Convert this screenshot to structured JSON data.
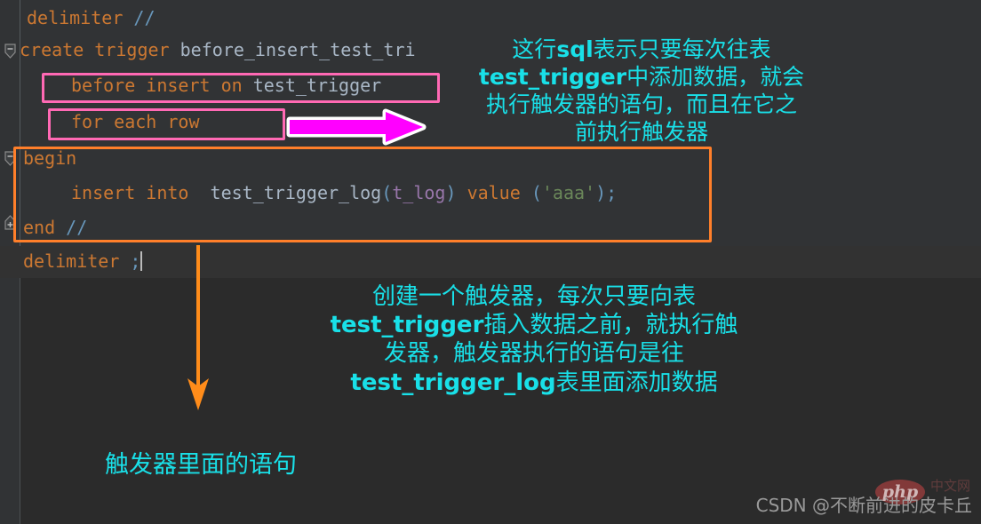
{
  "editor": {
    "background_color": "#2b2b2b",
    "code_background_color": "#313335",
    "lines": [
      {
        "id": "line-delimiter-open",
        "indent": 0,
        "tokens": [
          {
            "text": "delimiter ",
            "cls": "kw"
          },
          {
            "text": "//",
            "cls": "op"
          }
        ],
        "plain": "delimiter //"
      },
      {
        "id": "line-create-trigger",
        "indent": 0,
        "tokens": [
          {
            "text": "create trigger ",
            "cls": "kw"
          },
          {
            "text": "before_insert_test_tri",
            "cls": "id"
          }
        ],
        "plain": "create trigger before_insert_test_tri"
      },
      {
        "id": "line-before-insert-on",
        "indent": 1,
        "tokens": [
          {
            "text": "before insert on ",
            "cls": "kw"
          },
          {
            "text": "test_trigger",
            "cls": "id"
          }
        ],
        "plain": "before insert on test_trigger"
      },
      {
        "id": "line-for-each-row",
        "indent": 1,
        "tokens": [
          {
            "text": "for each row",
            "cls": "kw"
          }
        ],
        "plain": "for each row"
      },
      {
        "id": "line-begin",
        "indent": 0,
        "tokens": [
          {
            "text": "begin",
            "cls": "kw"
          }
        ],
        "plain": "begin"
      },
      {
        "id": "line-insert-into",
        "indent": 1,
        "tokens": [
          {
            "text": "insert into ",
            "cls": "kw"
          },
          {
            "text": " test_trigger_log",
            "cls": "id"
          },
          {
            "text": "(",
            "cls": "op"
          },
          {
            "text": "t_log",
            "cls": "fld"
          },
          {
            "text": ") ",
            "cls": "op"
          },
          {
            "text": "value ",
            "cls": "kw"
          },
          {
            "text": "(",
            "cls": "op"
          },
          {
            "text": "'aaa'",
            "cls": "str"
          },
          {
            "text": ");",
            "cls": "op"
          }
        ],
        "plain": "insert into  test_trigger_log(t_log) value ('aaa');"
      },
      {
        "id": "line-end",
        "indent": 0,
        "tokens": [
          {
            "text": "end ",
            "cls": "kw"
          },
          {
            "text": "//",
            "cls": "op"
          }
        ],
        "plain": "end //"
      },
      {
        "id": "line-delimiter-close",
        "indent": 0,
        "tokens": [
          {
            "text": "delimiter ",
            "cls": "kw"
          },
          {
            "text": ";",
            "cls": "op"
          }
        ],
        "plain": "delimiter ;"
      }
    ],
    "fold_markers": [
      {
        "id": "fold-create-trigger",
        "state": "expanded",
        "glyph": "minus"
      },
      {
        "id": "fold-begin",
        "state": "expanded",
        "glyph": "minus"
      },
      {
        "id": "fold-end",
        "state": "end",
        "glyph": "plus"
      }
    ]
  },
  "annotations": {
    "highlight_boxes": [
      {
        "id": "pink-box-before-insert",
        "color": "#ff69b4",
        "target": "before insert on test_trigger"
      },
      {
        "id": "pink-box-for-each-row",
        "color": "#ff69b4",
        "target": "for each row"
      },
      {
        "id": "orange-box-body",
        "color": "#ff7f2a",
        "target": "begin ... end //"
      }
    ],
    "arrows": [
      {
        "id": "magenta-arrow-right",
        "color": "#ff00ff",
        "outline": "#ffffff",
        "direction": "right"
      },
      {
        "id": "orange-arrow-down",
        "color": "#ff8c1a",
        "direction": "down"
      }
    ],
    "notes": {
      "top": {
        "color": "#19e0e8",
        "lines": [
          [
            {
              "t": "这行",
              "b": false
            },
            {
              "t": "sql",
              "b": true
            },
            {
              "t": "表示只要每次往表",
              "b": false
            }
          ],
          [
            {
              "t": "test_trigger",
              "b": true
            },
            {
              "t": "中添加数据，就会",
              "b": false
            }
          ],
          [
            {
              "t": "执行触发器的语句，而且在它之",
              "b": false
            }
          ],
          [
            {
              "t": "前执行触发器",
              "b": false
            }
          ]
        ],
        "plain": "这行sql表示只要每次往表test_trigger中添加数据，就会执行触发器的语句，而且在它之前执行触发器"
      },
      "middle": {
        "color": "#19e0e8",
        "lines": [
          [
            {
              "t": "创建一个触发器，每次只要向表",
              "b": false
            }
          ],
          [
            {
              "t": "test_trigger",
              "b": true
            },
            {
              "t": "插入数据之前，就执行触",
              "b": false
            }
          ],
          [
            {
              "t": "发器，触发器执行的语句是往",
              "b": false
            }
          ],
          [
            {
              "t": "test_trigger_log",
              "b": true
            },
            {
              "t": "表里面添加数据",
              "b": false
            }
          ]
        ],
        "plain": "创建一个触发器，每次只要向表test_trigger插入数据之前，就执行触发器，触发器执行的语句是往test_trigger_log表里面添加数据"
      },
      "bottom": {
        "color": "#19e0e8",
        "lines": [
          [
            {
              "t": "触发器里面的语句",
              "b": false
            }
          ]
        ],
        "plain": "触发器里面的语句"
      }
    }
  },
  "watermark": {
    "text": "CSDN @不断前进的皮卡丘",
    "badge": "php",
    "badge_sub": "中文网",
    "color": "#9a9a9a"
  }
}
